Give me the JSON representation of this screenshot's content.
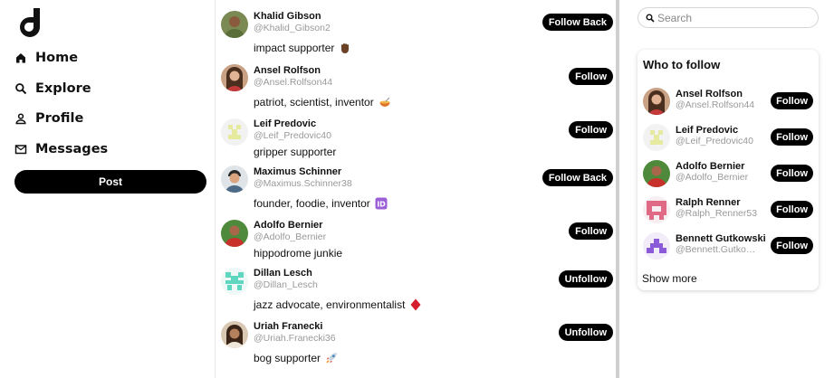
{
  "nav": {
    "logo_icon": "brand-logo-icon",
    "items": [
      {
        "label": "Home",
        "icon": "home-icon"
      },
      {
        "label": "Explore",
        "icon": "search-icon"
      },
      {
        "label": "Profile",
        "icon": "user-icon"
      },
      {
        "label": "Messages",
        "icon": "mail-icon"
      }
    ],
    "post_label": "Post"
  },
  "feed": {
    "rows": [
      {
        "name": "Khalid Gibson",
        "handle": "@Khalid_Gibson2",
        "bio": "impact supporter",
        "emoji": "raised-hand",
        "button": "Follow Back",
        "avatar": "photo"
      },
      {
        "name": "Ansel Rolfson",
        "handle": "@Ansel.Rolfson44",
        "bio": "patriot, scientist, inventor",
        "emoji": "bowl-with-spoon",
        "button": "Follow",
        "avatar": "photo"
      },
      {
        "name": "Leif Predovic",
        "handle": "@Leif_Predovic40",
        "bio": "gripper supporter",
        "emoji": "",
        "button": "Follow",
        "avatar": "identicon-yellow"
      },
      {
        "name": "Maximus Schinner",
        "handle": "@Maximus.Schinner38",
        "bio": "founder, foodie, inventor",
        "emoji": "id-button",
        "button": "Follow Back",
        "avatar": "photo"
      },
      {
        "name": "Adolfo Bernier",
        "handle": "@Adolfo_Bernier",
        "bio": "hippodrome junkie",
        "emoji": "",
        "button": "Follow",
        "avatar": "photo"
      },
      {
        "name": "Dillan Lesch",
        "handle": "@Dillan_Lesch",
        "bio": "jazz advocate, environmentalist",
        "emoji": "diamond-suit",
        "button": "Unfollow",
        "avatar": "identicon-teal"
      },
      {
        "name": "Uriah Franecki",
        "handle": "@Uriah.Franecki36",
        "bio": "bog supporter",
        "emoji": "rocket",
        "button": "Unfollow",
        "avatar": "photo"
      }
    ]
  },
  "search": {
    "placeholder": "Search",
    "value": ""
  },
  "who_to_follow": {
    "title": "Who to follow",
    "items": [
      {
        "name": "Ansel Rolfson",
        "handle": "@Ansel.Rolfson44",
        "button": "Follow"
      },
      {
        "name": "Leif Predovic",
        "handle": "@Leif_Predovic40",
        "button": "Follow"
      },
      {
        "name": "Adolfo Bernier",
        "handle": "@Adolfo_Bernier",
        "button": "Follow"
      },
      {
        "name": "Ralph Renner",
        "handle": "@Ralph_Renner53",
        "button": "Follow"
      },
      {
        "name": "Bennett Gutkowski",
        "handle": "@Bennett.Gutko…",
        "button": "Follow"
      }
    ],
    "show_more": "Show more"
  },
  "colors": {
    "button_bg": "#000000",
    "handle_text": "#999999",
    "divider": "#e6e6e6",
    "scrollbar": "#cfcfcf",
    "identicon_yellow": "#e9ecb8",
    "identicon_teal": "#5fd6c0",
    "identicon_pink": "#e06a86",
    "identicon_purple": "#8a5ad8"
  }
}
